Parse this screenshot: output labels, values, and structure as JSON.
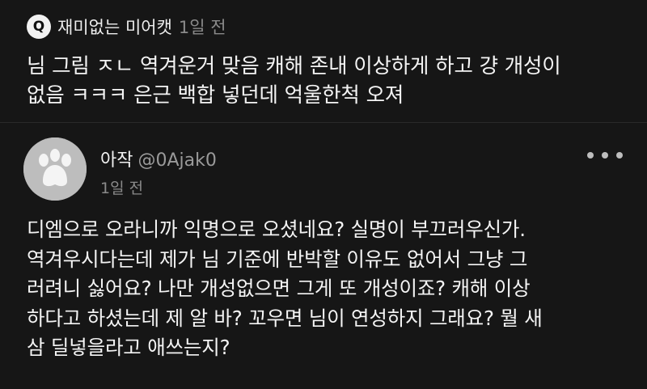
{
  "question": {
    "badge": "Q",
    "author": "재미없는 미어캣",
    "time": "1일 전",
    "text": "님 그림 ㅈㄴ 역겨운거 맞음 캐해 존내 이상하게 하고 걍 개성이\n없음 ㅋㅋㅋ 은근 백합 넣던데 억울한척 오져"
  },
  "answer": {
    "user_name": "아작",
    "user_handle": "@0Ajak0",
    "time": "1일 전",
    "avatar_icon": "paw-avatar-icon",
    "more_icon": "more-dots-icon",
    "text": "디엠으로 오라니까 익명으로 오셨네요? 실명이 부끄러우신가.\n역겨우시다는데 제가 님 기준에 반박할 이유도 없어서 그냥 그\n러려니 싫어요? 나만 개성없으면 그게 또 개성이죠? 캐해 이상\n하다고 하셨는데 제 알 바? 꼬우면 님이 연성하지 그래요? 뭘 새\n삼 딜넣을라고 애쓰는지?"
  }
}
